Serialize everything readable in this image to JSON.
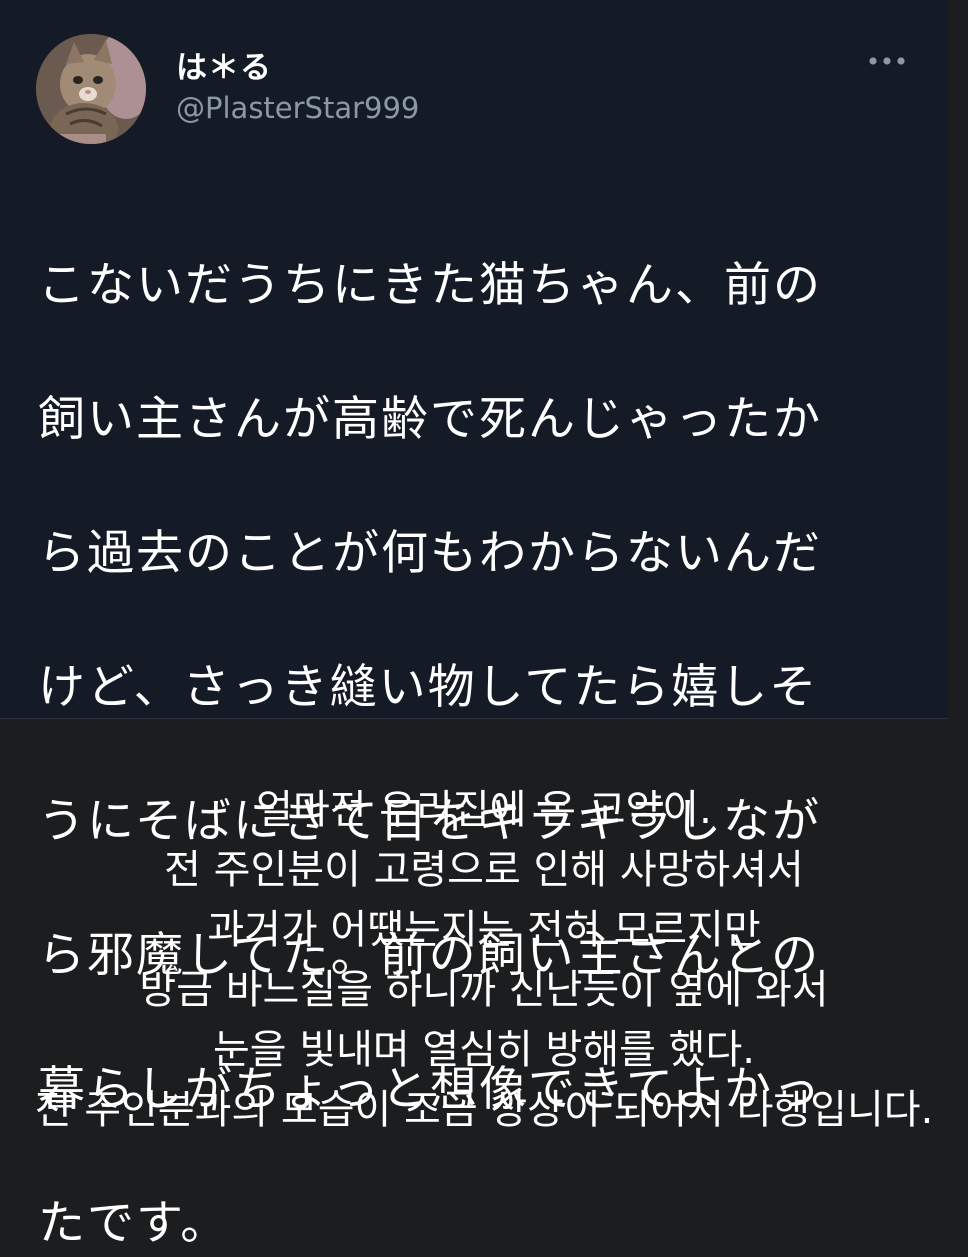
{
  "tweet": {
    "display_name": "は＊る",
    "handle": "@PlasterStar999",
    "text_lines": [
      "こないだうちにきた猫ちゃん、前の",
      "飼い主さんが高齢で死んじゃったか",
      "ら過去のことが何もわからないんだ",
      "けど、さっき縫い物してたら嬉しそ",
      "うにそばにきて目をキラキラしなが",
      "ら邪魔してた。前の飼い主さんとの",
      "暮らしがちょっと想像できてよかっ",
      "たです。"
    ]
  },
  "translation": {
    "lines": [
      "얼마전 우리집에 온 고양이.",
      "전 주인분이 고령으로 인해 사망하셔서",
      "과거가 어땠는지는 전혀 모르지만",
      "방금 바느질을 하니까 신난듯이 옆에 와서",
      "눈을 빛내며 열심히 방해를 했다.",
      "전 주인분과의 모습이 조금 상상이 되어서 다행입니다."
    ]
  },
  "icons": {
    "avatar": "cat-photo-avatar",
    "more": "more-options-icon"
  },
  "colors": {
    "tweet_background": "#151b26",
    "page_background": "#1b1d1f",
    "handle_gray": "#8b98a5"
  }
}
